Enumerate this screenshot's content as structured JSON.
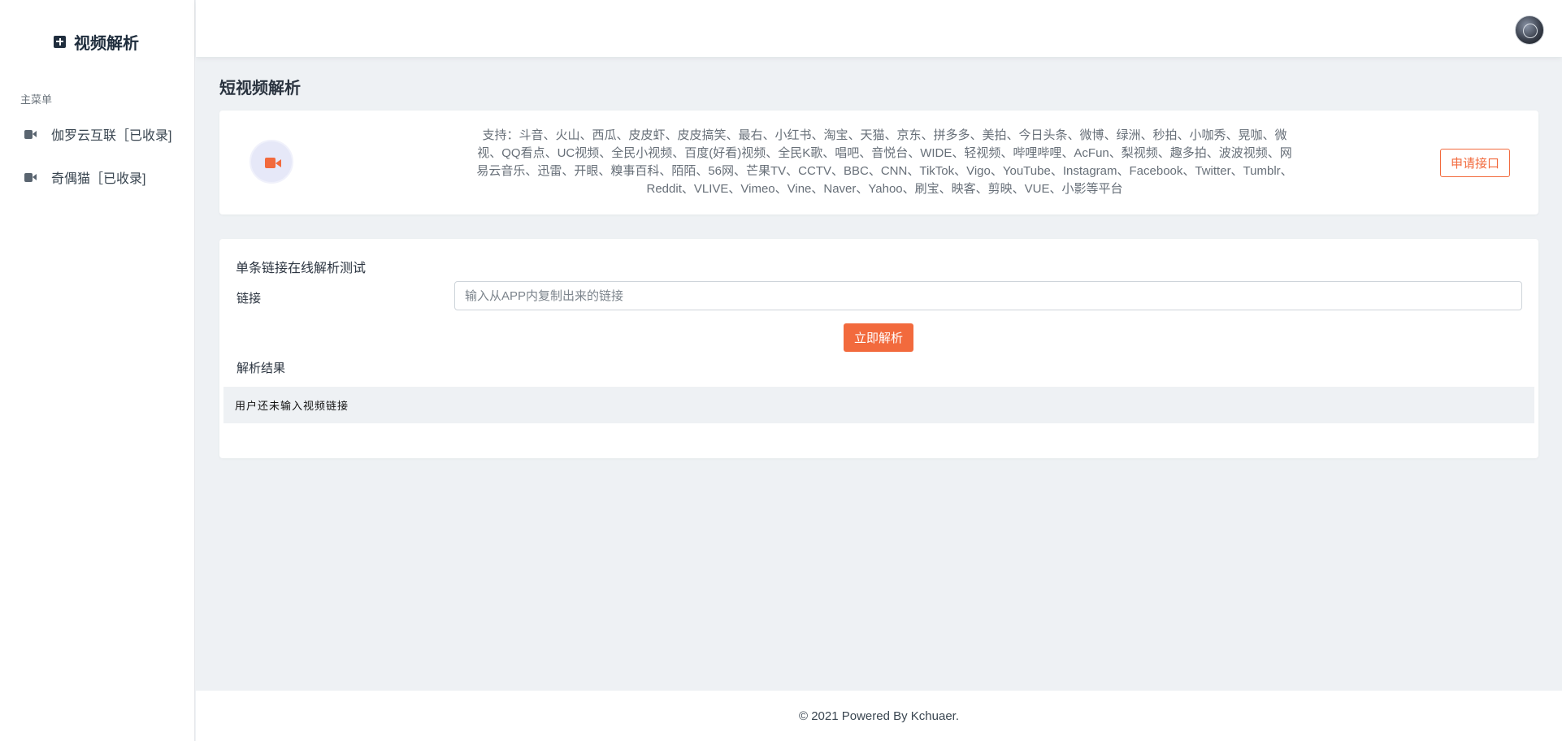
{
  "sidebar": {
    "brand": "视频解析",
    "menu_title": "主菜单",
    "items": [
      {
        "label": "伽罗云互联［已收录]",
        "icon": "video-camera-icon"
      },
      {
        "label": "奇偶猫［已收录]",
        "icon": "video-camera-icon"
      }
    ]
  },
  "header": {
    "avatar": "user-avatar"
  },
  "main": {
    "page_title": "短视频解析",
    "support": {
      "text": "支持：斗音、火山、西瓜、皮皮虾、皮皮搞笑、最右、小红书、淘宝、天猫、京东、拼多多、美拍、今日头条、微博、绿洲、秒拍、小咖秀、晃咖、微视、QQ看点、UC视频、全民小视频、百度(好看)视频、全民K歌、唱吧、音悦台、WIDE、轻视频、哔哩哔哩、AcFun、梨视频、趣多拍、波波视频、网易云音乐、迅雷、开眼、糗事百科、陌陌、56网、芒果TV、CCTV、BBC、CNN、TikTok、Vigo、YouTube、Instagram、Facebook、Twitter、Tumblr、Reddit、VLIVE、Vimeo、Vine、Naver、Yahoo、刷宝、映客、剪映、VUE、小影等平台",
      "apply_button": "申请接口"
    },
    "test": {
      "title": "单条链接在线解析测试",
      "link_label": "链接",
      "link_placeholder": "输入从APP内复制出来的链接",
      "link_value": "",
      "parse_button": "立即解析",
      "result_label": "解析结果",
      "result_text": "用户还未输入视频链接"
    }
  },
  "footer": {
    "text": "© 2021 Powered By Kchuaer."
  },
  "colors": {
    "accent": "#f26a3d",
    "background": "#eef1f4",
    "sidebar_text": "#3a4651"
  }
}
